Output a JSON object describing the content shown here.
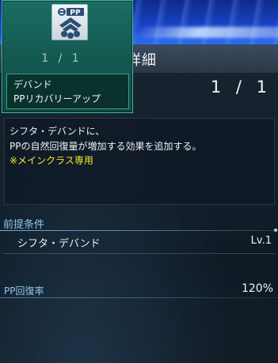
{
  "window": {
    "title": "詳細"
  },
  "skill_card": {
    "icon": "pp-recovery-skill-icon",
    "level": "1 / 1",
    "category": "デバンド",
    "name": "PPリカバリーアップ"
  },
  "level_display": "1 / 1",
  "description": {
    "line1": "シフタ・デバンドに、",
    "line2": "PPの自然回復量が増加する効果を追加する。",
    "note": "※メインクラス専用"
  },
  "prerequisites": {
    "heading": "前提条件",
    "skill_name": "シフタ・デバンド",
    "skill_level": "Lv.1"
  },
  "stats": {
    "label": "PP回復率",
    "value": "120%"
  },
  "colors": {
    "card_teal": "#1b6d63",
    "highlight_yellow": "#f5ec2a",
    "section_blue": "#8ec6ea"
  }
}
